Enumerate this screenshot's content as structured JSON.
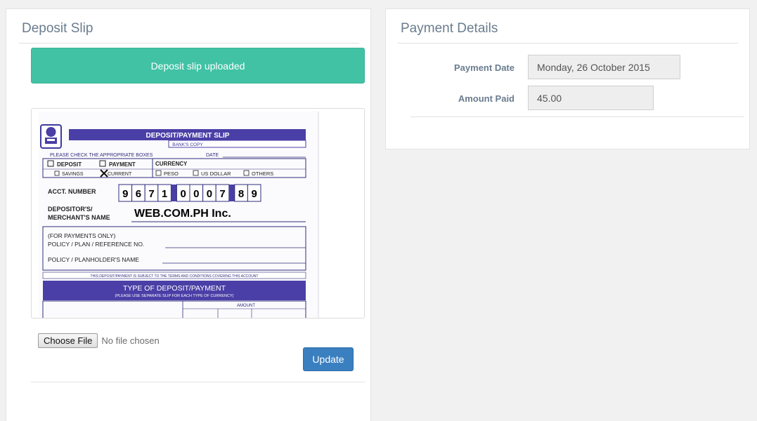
{
  "deposit": {
    "title": "Deposit Slip",
    "alert": "Deposit slip uploaded",
    "file_button": "Choose File",
    "file_status": "No file chosen",
    "update_label": "Update"
  },
  "slip": {
    "title": "DEPOSIT/PAYMENT SLIP",
    "copy": "BANK'S COPY",
    "check_boxes": "PLEASE CHECK THE APPROPRIATE BOXES",
    "date": "DATE",
    "deposit": "DEPOSIT",
    "payment": "PAYMENT",
    "currency": "CURRENCY",
    "savings": "SAVINGS",
    "current": "CURRENT",
    "peso": "PESO",
    "us_dollar": "US DOLLAR",
    "others": "OTHERS",
    "acct_label": "ACCT. NUMBER",
    "acct_digits": [
      "9",
      "6",
      "7",
      "1",
      "0",
      "0",
      "0",
      "7",
      "8",
      "9"
    ],
    "depositor_label_1": "DEPOSITOR'S/",
    "depositor_label_2": "MERCHANT'S NAME",
    "depositor_name": "WEB.COM.PH Inc.",
    "payments_only": "(FOR PAYMENTS ONLY)",
    "policy_ref": "POLICY / PLAN / REFERENCE NO.",
    "policy_name": "POLICY / PLANHOLDER'S NAME",
    "terms": "THIS DEPOSIT/PAYMENT IS SUBJECT TO THE TERMS AND CONDITIONS COVERING THIS ACCOUNT",
    "type_title": "TYPE OF DEPOSIT/PAYMENT",
    "type_sub": "(PLEASE USE SEPARATE SLIP FOR EACH TYPE OF CURRENCY)",
    "amount": "AMOUNT"
  },
  "payment": {
    "title": "Payment Details",
    "date_label": "Payment Date",
    "date_value": "Monday, 26 October 2015",
    "amount_label": "Amount Paid",
    "amount_value": "45.00"
  },
  "colors": {
    "accent": "#41c2a5",
    "primary": "#3a7fbf",
    "slip_blue": "#4a3fa6"
  }
}
